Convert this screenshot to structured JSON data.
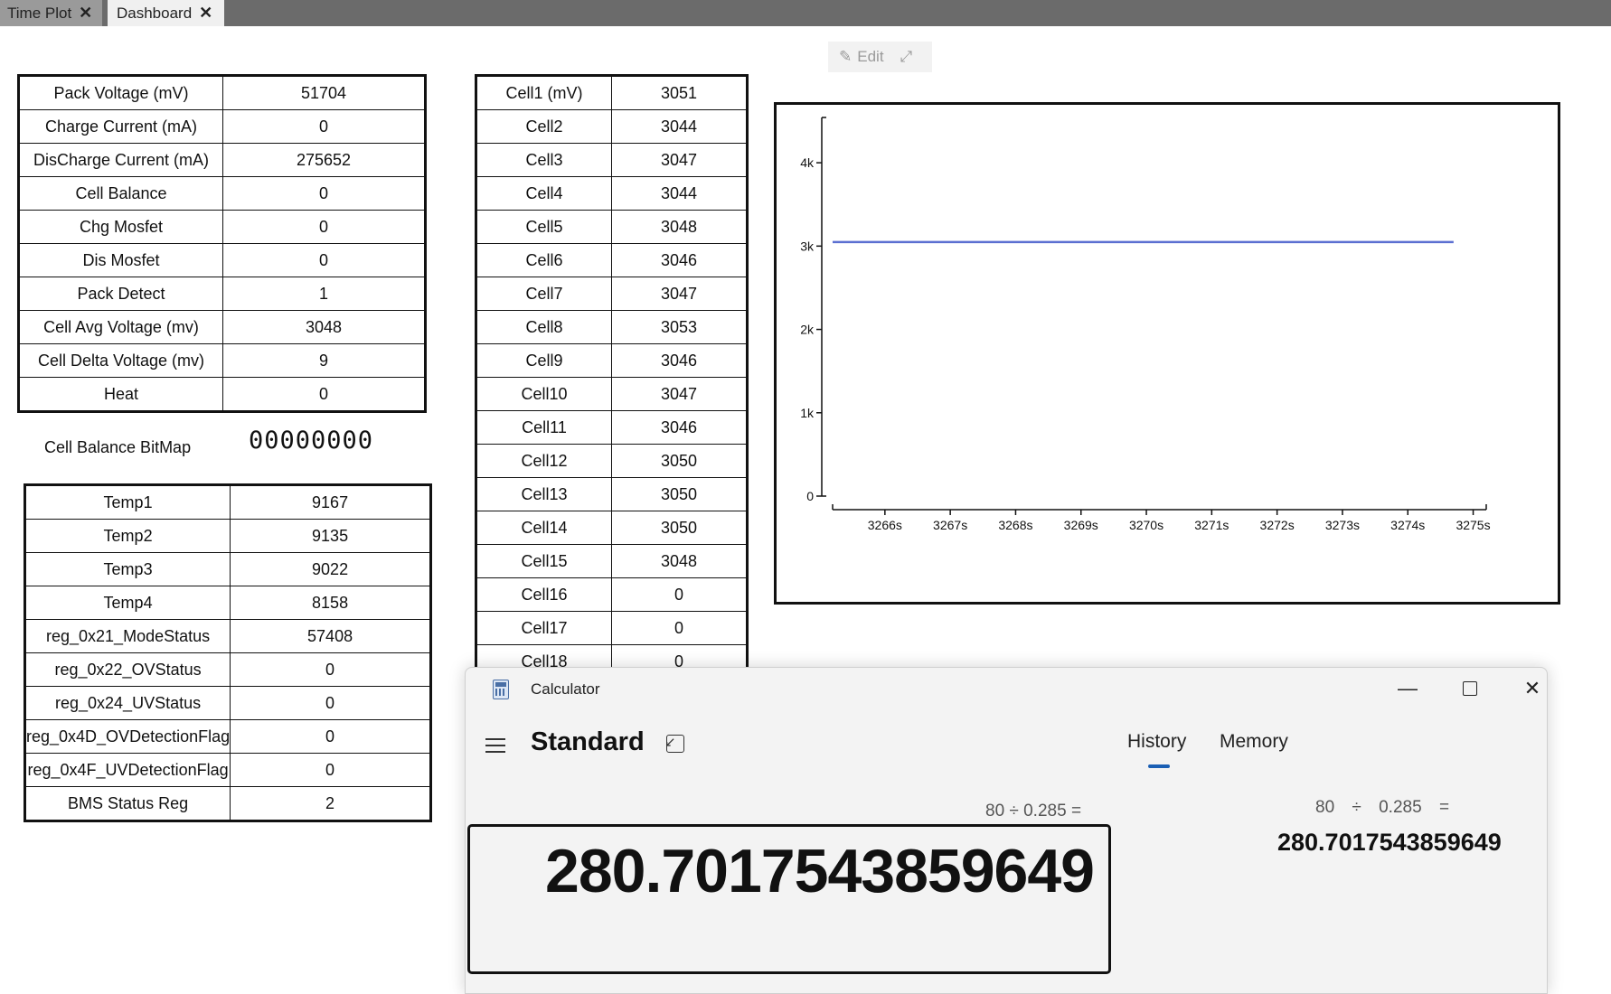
{
  "tabs": [
    {
      "label": "Time Plot"
    },
    {
      "label": "Dashboard"
    }
  ],
  "toolbar": {
    "edit_label": "Edit"
  },
  "pack_table": [
    {
      "label": "Pack Voltage (mV)",
      "value": "51704"
    },
    {
      "label": "Charge Current (mA)",
      "value": "0"
    },
    {
      "label": "DisCharge Current (mA)",
      "value": "275652"
    },
    {
      "label": "Cell Balance",
      "value": "0"
    },
    {
      "label": "Chg Mosfet",
      "value": "0"
    },
    {
      "label": "Dis Mosfet",
      "value": "0"
    },
    {
      "label": "Pack Detect",
      "value": "1"
    },
    {
      "label": "Cell Avg Voltage (mv)",
      "value": "3048"
    },
    {
      "label": "Cell Delta Voltage (mv)",
      "value": "9"
    },
    {
      "label": "Heat",
      "value": "0"
    }
  ],
  "cell_balance_bitmap": {
    "label": "Cell Balance BitMap",
    "value": "00000000"
  },
  "temp_table": [
    {
      "label": "Temp1",
      "value": "9167"
    },
    {
      "label": "Temp2",
      "value": "9135"
    },
    {
      "label": "Temp3",
      "value": "9022"
    },
    {
      "label": "Temp4",
      "value": "8158"
    },
    {
      "label": "reg_0x21_ModeStatus",
      "value": "57408"
    },
    {
      "label": "reg_0x22_OVStatus",
      "value": "0"
    },
    {
      "label": "reg_0x24_UVStatus",
      "value": "0"
    },
    {
      "label": "reg_0x4D_OVDetectionFlag",
      "value": "0"
    },
    {
      "label": "reg_0x4F_UVDetectionFlag",
      "value": "0"
    },
    {
      "label": "BMS Status Reg",
      "value": "2"
    }
  ],
  "cell_table": [
    {
      "label": "Cell1 (mV)",
      "value": "3051"
    },
    {
      "label": "Cell2",
      "value": "3044"
    },
    {
      "label": "Cell3",
      "value": "3047"
    },
    {
      "label": "Cell4",
      "value": "3044"
    },
    {
      "label": "Cell5",
      "value": "3048"
    },
    {
      "label": "Cell6",
      "value": "3046"
    },
    {
      "label": "Cell7",
      "value": "3047"
    },
    {
      "label": "Cell8",
      "value": "3053"
    },
    {
      "label": "Cell9",
      "value": "3046"
    },
    {
      "label": "Cell10",
      "value": "3047"
    },
    {
      "label": "Cell11",
      "value": "3046"
    },
    {
      "label": "Cell12",
      "value": "3050"
    },
    {
      "label": "Cell13",
      "value": "3050"
    },
    {
      "label": "Cell14",
      "value": "3050"
    },
    {
      "label": "Cell15",
      "value": "3048"
    },
    {
      "label": "Cell16",
      "value": "0"
    },
    {
      "label": "Cell17",
      "value": "0"
    },
    {
      "label": "Cell18",
      "value": "0"
    }
  ],
  "chart_data": {
    "type": "line",
    "title": "",
    "xlabel": "",
    "ylabel": "",
    "xlim": [
      3265.2,
      3275.2
    ],
    "ylim": [
      0,
      4500
    ],
    "x_ticks": [
      "3266s",
      "3267s",
      "3268s",
      "3269s",
      "3270s",
      "3271s",
      "3272s",
      "3273s",
      "3274s",
      "3275s"
    ],
    "x_tick_values": [
      3266,
      3267,
      3268,
      3269,
      3270,
      3271,
      3272,
      3273,
      3274,
      3275
    ],
    "y_ticks": [
      "0",
      "1k",
      "2k",
      "3k",
      "4k"
    ],
    "y_tick_values": [
      0,
      1000,
      2000,
      3000,
      4000
    ],
    "grid": false,
    "color": "#5b6fd1",
    "series": [
      {
        "x": [
          3265.2,
          3266,
          3267,
          3268,
          3269,
          3270,
          3271,
          3272,
          3273,
          3274,
          3274.7
        ],
        "values": [
          3048,
          3048,
          3048,
          3048,
          3048,
          3048,
          3048,
          3048,
          3048,
          3048,
          3048
        ]
      }
    ]
  },
  "calculator": {
    "title": "Calculator",
    "mode": "Standard",
    "tabs": {
      "history": "History",
      "memory": "Memory"
    },
    "expression": "80 ÷ 0.285 =",
    "display": "280.7017543859649",
    "history": {
      "expression": "80 ÷ 0.285 =",
      "result": "280.7017543859649"
    },
    "accent_color": "#1a5fb4"
  }
}
